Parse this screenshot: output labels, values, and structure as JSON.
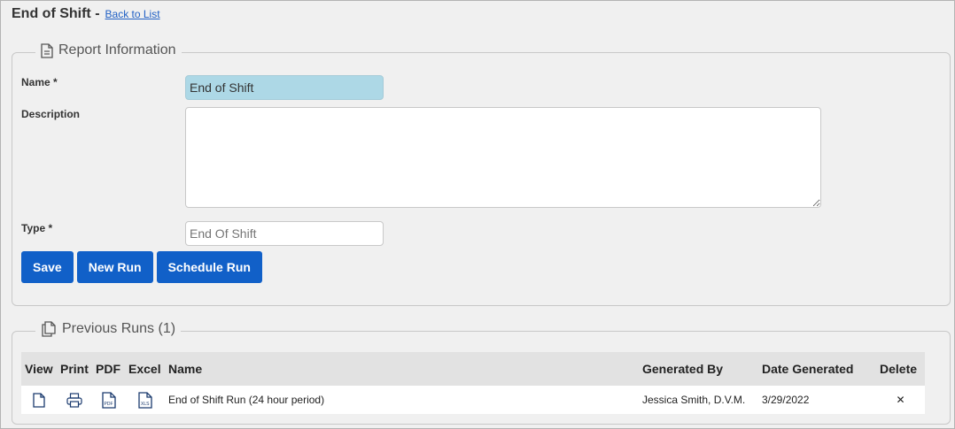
{
  "header": {
    "title": "End of Shift -",
    "back_link": "Back to List"
  },
  "report_info": {
    "legend": "Report Information",
    "name_label": "Name *",
    "name_value": "End of Shift",
    "description_label": "Description",
    "description_value": "",
    "type_label": "Type *",
    "type_placeholder": "End Of Shift",
    "buttons": {
      "save": "Save",
      "new_run": "New Run",
      "schedule_run": "Schedule Run"
    },
    "colors": {
      "button": "#1160c8",
      "name_field": "#add8e6"
    }
  },
  "previous_runs": {
    "legend": "Previous Runs (1)",
    "columns": [
      "View",
      "Print",
      "PDF",
      "Excel",
      "Name",
      "Generated By",
      "Date Generated",
      "Delete"
    ],
    "rows": [
      {
        "view_icon": "document-icon",
        "print_icon": "printer-icon",
        "pdf_icon": "pdf-file-icon",
        "excel_icon": "xls-file-icon",
        "name": "End of Shift Run (24 hour period)",
        "generated_by": "Jessica Smith, D.V.M.",
        "date_generated": "3/29/2022",
        "delete": "✕"
      }
    ]
  }
}
